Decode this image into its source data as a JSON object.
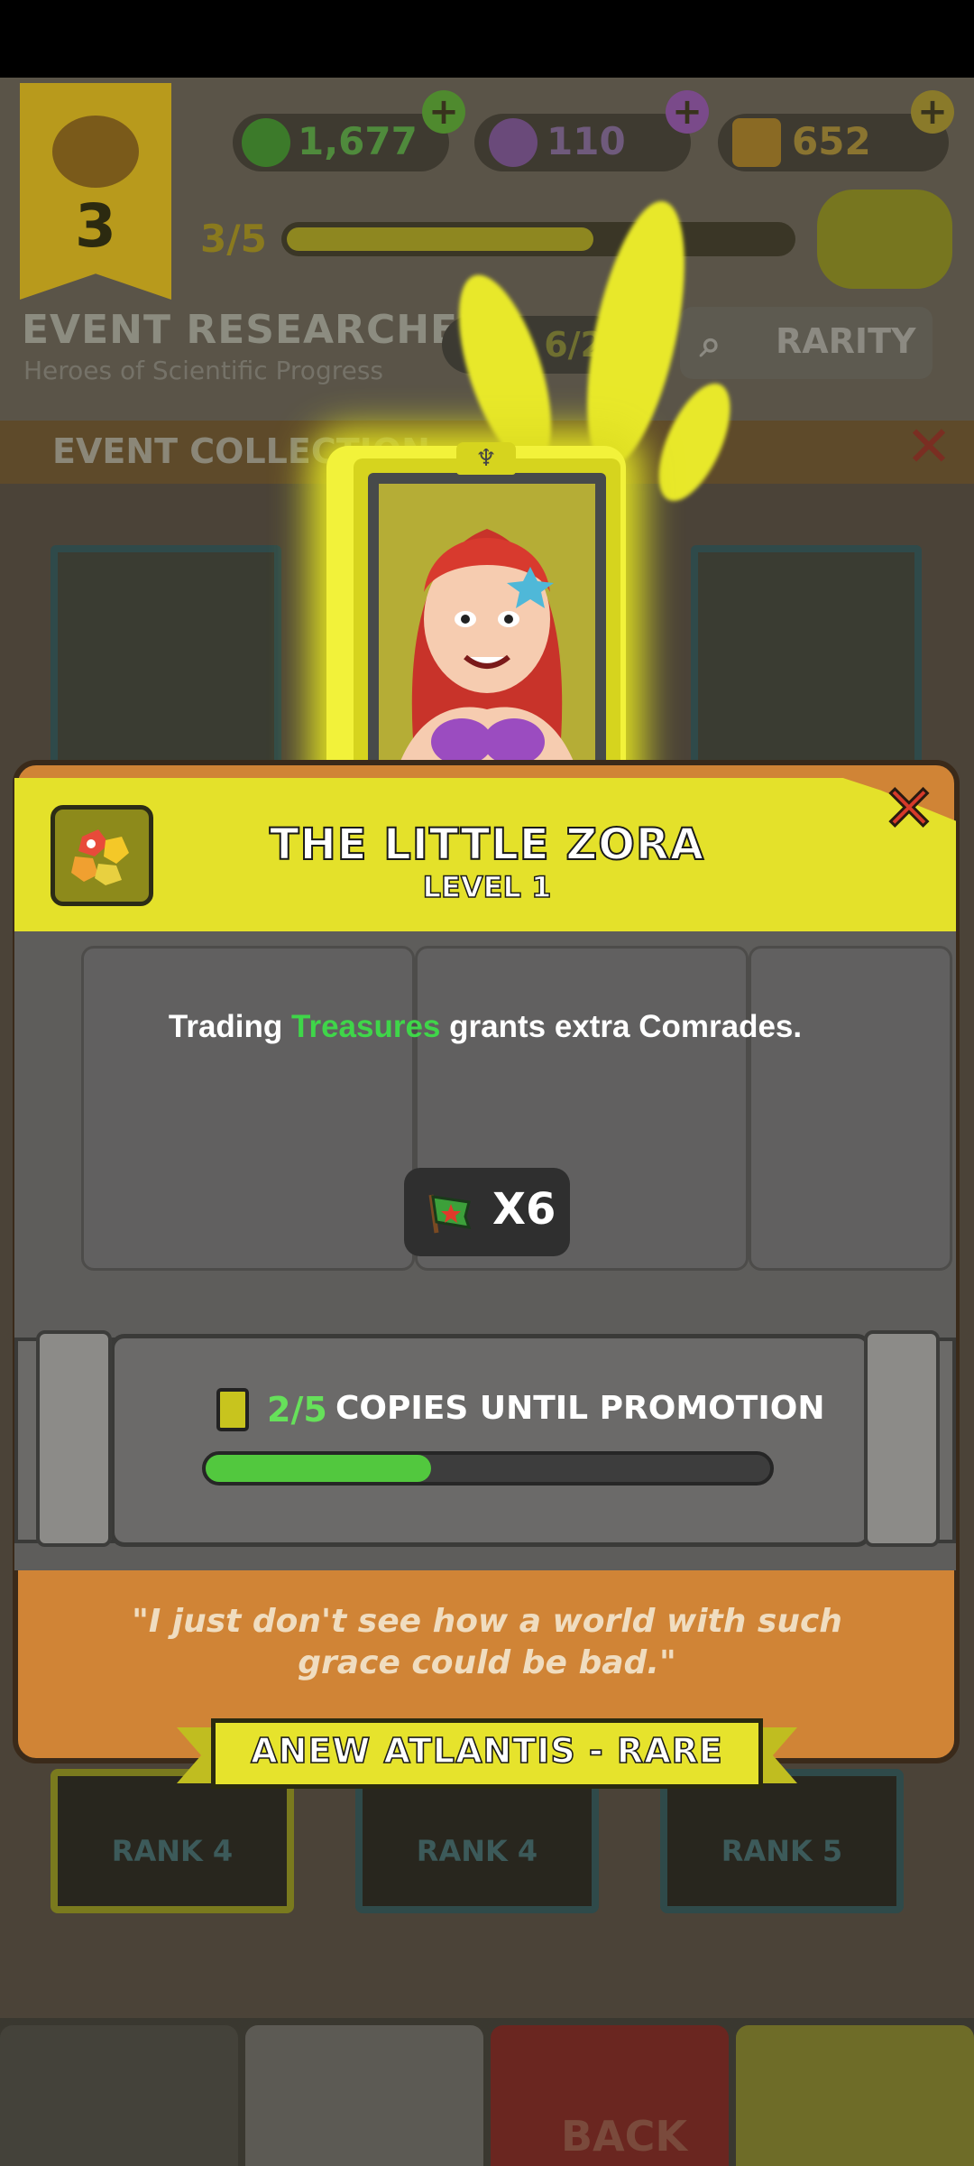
{
  "hud": {
    "level": "3",
    "level_progress": "3/5",
    "level_progress_value": 0.6,
    "cash": "1,677",
    "potions": "110",
    "gold": "652"
  },
  "event": {
    "title": "EVENT RESEARCHERS",
    "subtitle": "Heroes of Scientific Progress",
    "count": "6/2",
    "rarity_label": "RARITY",
    "collection_label": "EVENT COLLECTION",
    "rank_labels": [
      "RANK 4",
      "RANK 4",
      "RANK 5"
    ]
  },
  "nav": {
    "back_label": "BACK"
  },
  "card": {
    "name": "THE LITTLE ZORA",
    "level": "LEVEL 1",
    "desc_pre": "Trading ",
    "desc_highlight": "Treasures",
    "desc_post": " grants extra Comrades.",
    "reward_amount": "X6",
    "reward_icon": "comrade-flag-icon",
    "copies_count": "2/5",
    "copies_label": "COPIES UNTIL PROMOTION",
    "copies_progress": 0.4,
    "quote_line1": "\"I just don't see how a world with such",
    "quote_line2": "grace could be bad.\"",
    "set_rarity": "ANEW ATLANTIS - RARE"
  },
  "colors": {
    "accent_yellow": "#e4e12a",
    "highlight_green": "#3fd649",
    "close_red": "#d63a2a"
  }
}
